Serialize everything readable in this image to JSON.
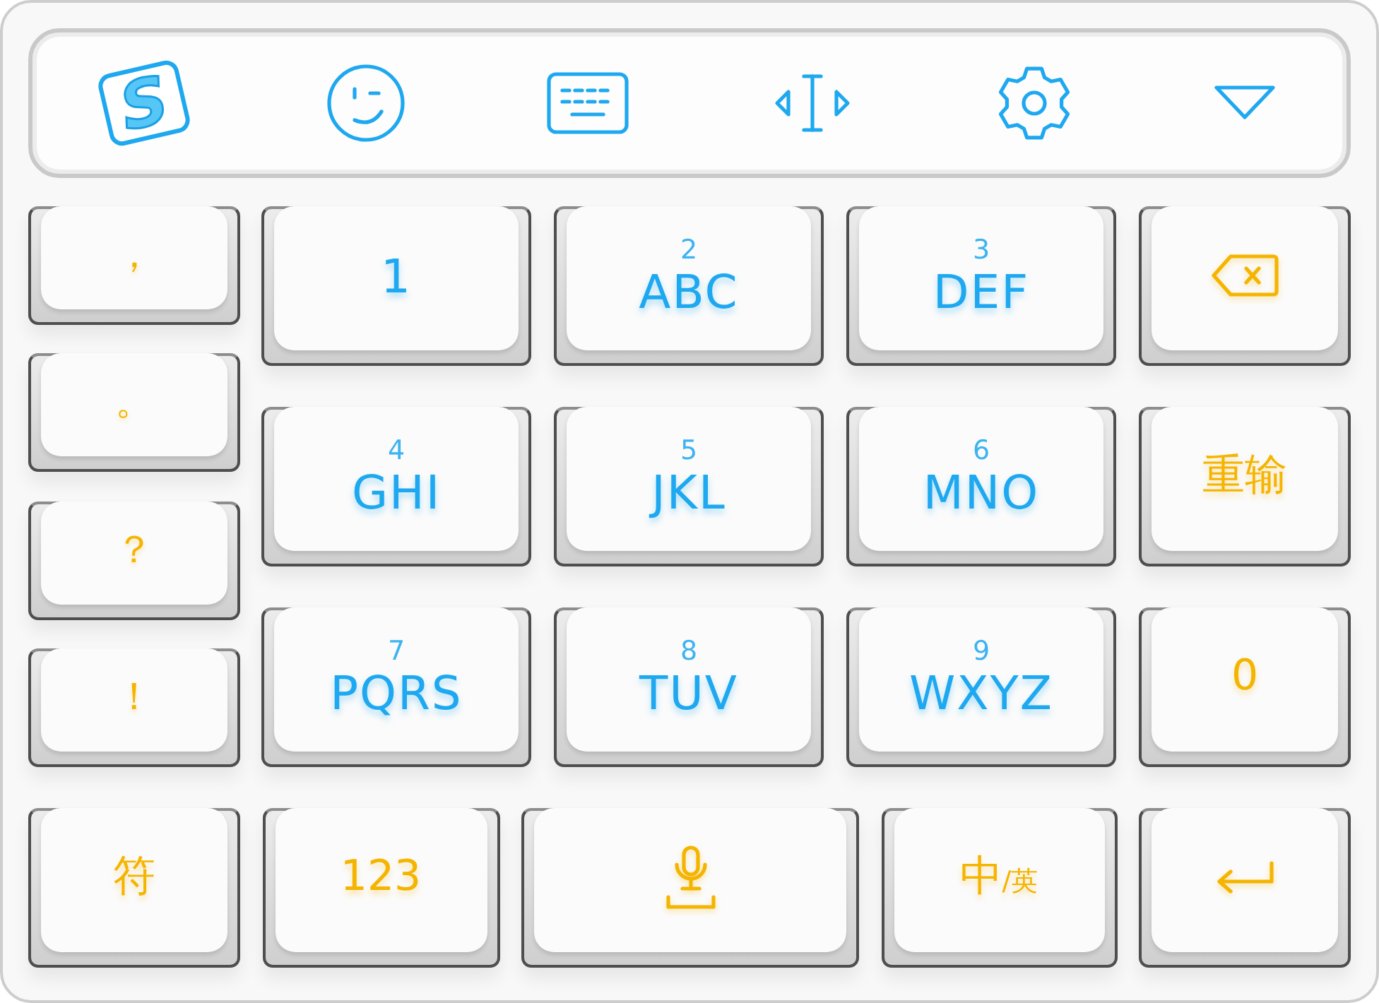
{
  "toolbar": [
    {
      "kind": "logo",
      "label": "S"
    },
    {
      "kind": "emoji"
    },
    {
      "kind": "keyboard"
    },
    {
      "kind": "cursor"
    },
    {
      "kind": "settings"
    },
    {
      "kind": "collapse"
    }
  ],
  "punctuation_keys": [
    "，",
    "。",
    "？",
    "！"
  ],
  "keypad": [
    {
      "kind": "digit",
      "label": "1"
    },
    {
      "kind": "letters",
      "number": "2",
      "label": "ABC"
    },
    {
      "kind": "letters",
      "number": "3",
      "label": "DEF"
    },
    {
      "kind": "backspace"
    },
    {
      "kind": "letters",
      "number": "4",
      "label": "GHI"
    },
    {
      "kind": "letters",
      "number": "5",
      "label": "JKL"
    },
    {
      "kind": "letters",
      "number": "6",
      "label": "MNO"
    },
    {
      "kind": "text",
      "label": "重输"
    },
    {
      "kind": "letters",
      "number": "7",
      "label": "PQRS"
    },
    {
      "kind": "letters",
      "number": "8",
      "label": "TUV"
    },
    {
      "kind": "letters",
      "number": "9",
      "label": "WXYZ"
    },
    {
      "kind": "text",
      "label": "0"
    }
  ],
  "bottom_row": [
    {
      "kind": "text",
      "label": "符"
    },
    {
      "kind": "text",
      "label": "123"
    },
    {
      "kind": "voice"
    },
    {
      "kind": "text",
      "label": "中$_{/英}$"
    },
    {
      "kind": "enter"
    }
  ]
}
